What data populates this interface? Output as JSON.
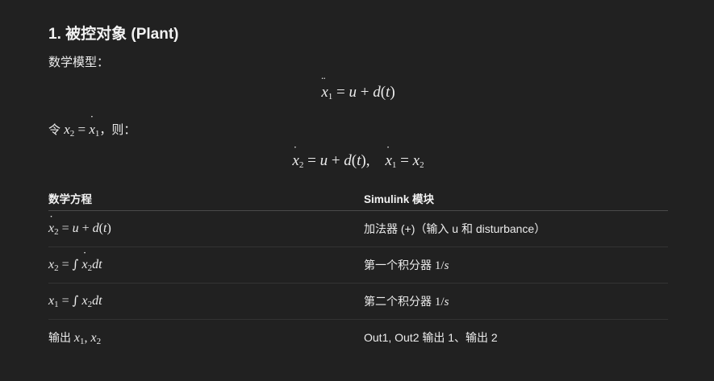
{
  "section": {
    "heading": "1. 被控对象 (Plant)",
    "intro": "数学模型："
  },
  "equations": {
    "eq1": "ẍ₁ = u + d(t)",
    "let_prefix": "令",
    "let_suffix": "，则：",
    "eq2": "ẋ₂ = u + d(t),    ẋ₁ = x₂"
  },
  "table": {
    "headers": [
      "数学方程",
      "Simulink 模块"
    ],
    "rows": [
      {
        "equation": "ẋ₂ = u + d(t)",
        "block": "加法器 (+)（输入 u 和 disturbance）"
      },
      {
        "equation": "x₂ = ∫ ẋ₂dt",
        "block_text": "第一个积分器",
        "block_math": "1/s"
      },
      {
        "equation": "x₁ = ∫ x₂dt",
        "block_text": "第二个积分器",
        "block_math": "1/s"
      },
      {
        "equation_prefix": "输出",
        "equation_math": "x₁, x₂",
        "block": "Out1, Out2 输出 1、输出 2"
      }
    ]
  }
}
